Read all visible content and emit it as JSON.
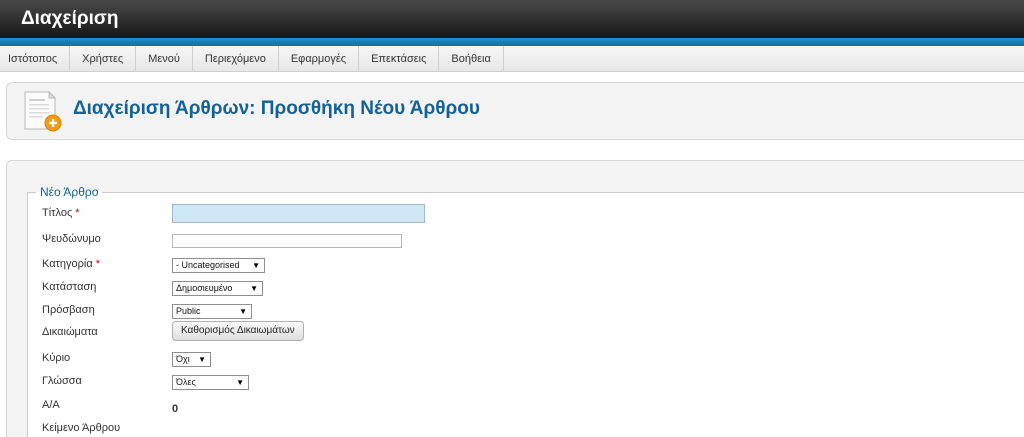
{
  "app": {
    "title": "Διαχείριση"
  },
  "menu": {
    "items": [
      {
        "label": "Ιστότοπος"
      },
      {
        "label": "Χρήστες"
      },
      {
        "label": "Μενού"
      },
      {
        "label": "Περιεχόμενο"
      },
      {
        "label": "Εφαρμογές"
      },
      {
        "label": "Επεκτάσεις"
      },
      {
        "label": "Βοήθεια"
      }
    ]
  },
  "header": {
    "title": "Διαχείριση Άρθρων: Προσθήκη Νέου Άρθρου",
    "icon": "article-add-icon"
  },
  "form": {
    "legend": "Νέο Άρθρο",
    "required_mark": "*",
    "title": {
      "label": "Τίτλος",
      "value": ""
    },
    "alias": {
      "label": "Ψευδώνυμο",
      "value": ""
    },
    "category": {
      "label": "Κατηγορία",
      "selected": "- Uncategorised"
    },
    "state": {
      "label": "Κατάσταση",
      "selected": "Δημοσιευμένο"
    },
    "access": {
      "label": "Πρόσβαση",
      "selected": "Public"
    },
    "permissions": {
      "label": "Δικαιώματα",
      "button": "Καθορισμός Δικαιωμάτων"
    },
    "featured": {
      "label": "Κύριο",
      "selected": "Όχι"
    },
    "language": {
      "label": "Γλώσσα",
      "selected": "Όλες"
    },
    "id": {
      "label": "Α/Α",
      "value": "0"
    },
    "text": {
      "label": "Κείμενο Άρθρου"
    }
  },
  "colors": {
    "accent": "#146295",
    "topbar": "#1a1a1a",
    "strip": "#1f8fc6",
    "required": "#cc0000"
  }
}
